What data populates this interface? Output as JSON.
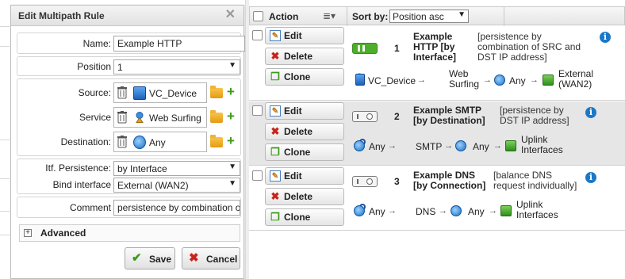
{
  "dialog": {
    "title": "Edit Multipath Rule",
    "close_glyph": "✕",
    "fields": {
      "name_label": "Name:",
      "name_value": "Example HTTP",
      "position_label": "Position",
      "position_value": "1",
      "source_label": "Source:",
      "source_value": "VC_Device",
      "service_label": "Service",
      "service_value": "Web Surfing",
      "destination_label": "Destination:",
      "destination_value": "Any",
      "itf_persistence_label": "Itf. Persistence:",
      "itf_persistence_value": "by Interface",
      "bind_interface_label": "Bind interface",
      "bind_interface_value": "External (WAN2)",
      "comment_label": "Comment",
      "comment_value": "persistence by combination of"
    },
    "advanced_label": "Advanced",
    "advanced_toggle": "+",
    "save_label": "Save",
    "cancel_label": "Cancel"
  },
  "table": {
    "header": {
      "action_label": "Action",
      "sort_by_label": "Sort by:",
      "sort_value": "Position asc"
    },
    "action_buttons": {
      "edit": "Edit",
      "delete": "Delete",
      "clone": "Clone"
    },
    "rules": [
      {
        "number": "1",
        "enabled": true,
        "name_lines": [
          "Example",
          "HTTP [by",
          "Interface]"
        ],
        "desc_lines": [
          "[persistence by",
          "combination of SRC and",
          "DST IP address]"
        ],
        "source": "VC_Device",
        "service_lines": [
          "Web",
          "Surfing"
        ],
        "destination": "Any",
        "interface_lines": [
          "External",
          "(WAN2)"
        ]
      },
      {
        "number": "2",
        "enabled": false,
        "name_lines": [
          "Example SMTP",
          "[by Destination]"
        ],
        "desc_lines": [
          "[persistence by",
          "DST IP address]"
        ],
        "source": "Any",
        "service_lines": [
          "SMTP"
        ],
        "destination": "Any",
        "interface_lines": [
          "Uplink",
          "Interfaces"
        ]
      },
      {
        "number": "3",
        "enabled": false,
        "name_lines": [
          "Example DNS",
          "[by Connection]"
        ],
        "desc_lines": [
          "[balance DNS",
          "request individually]"
        ],
        "source": "Any",
        "service_lines": [
          "DNS"
        ],
        "destination": "Any",
        "interface_lines": [
          "Uplink",
          "Interfaces"
        ]
      }
    ]
  },
  "icons": {
    "info": "info-icon",
    "trash": "trash-icon",
    "folder": "folder-icon",
    "add": "plus-icon",
    "globe": "globe-icon",
    "device": "device-icon",
    "service": "service-icon",
    "interface": "interface-icon",
    "edit": "edit-icon",
    "delete": "delete-icon",
    "clone": "clone-icon",
    "arrow": "→"
  },
  "colors": {
    "toggle_on": "#4cae2a",
    "info_blue": "#1a78c8",
    "add_green": "#3c9a1c",
    "delete_red": "#c8231c",
    "row_alt": "#e6e6e6"
  }
}
